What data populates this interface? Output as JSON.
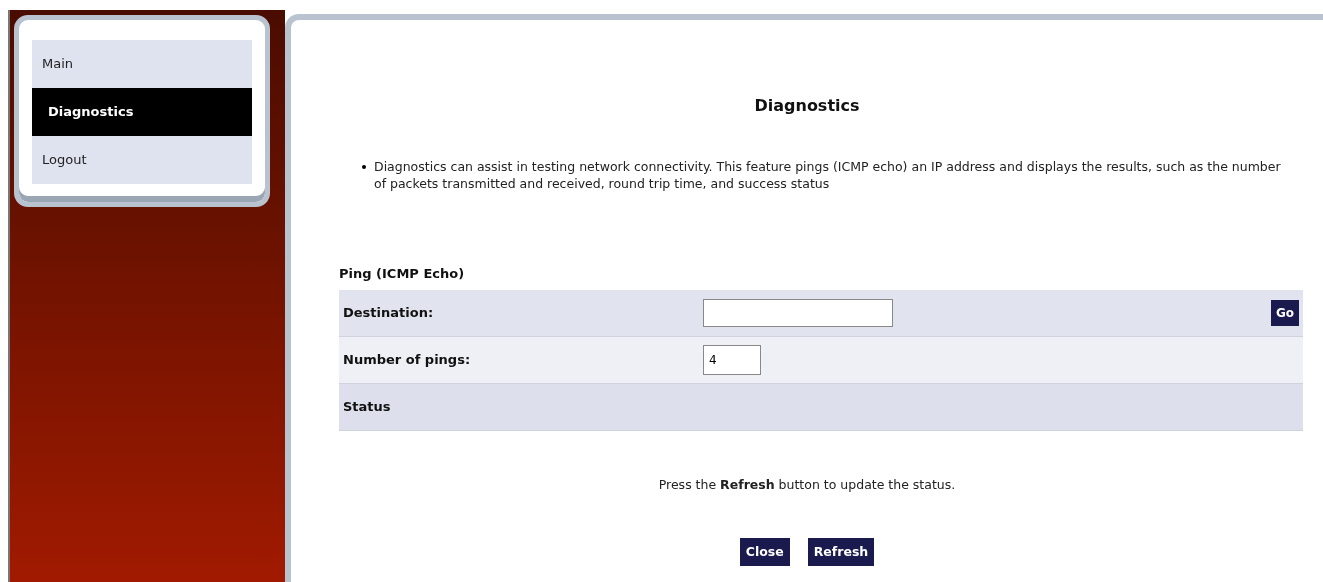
{
  "sidebar": {
    "items": [
      {
        "label": "Main",
        "selected": false
      },
      {
        "label": "Diagnostics",
        "selected": true
      },
      {
        "label": "Logout",
        "selected": false
      }
    ]
  },
  "content": {
    "title": "Diagnostics",
    "bullets": [
      "Diagnostics can assist in testing network connectivity. This feature pings (ICMP echo) an IP address and displays the results, such as the number of packets transmitted and received, round trip time, and success status"
    ],
    "section_title": "Ping (ICMP Echo)",
    "rows": [
      {
        "kind": "input_with_button",
        "label": "Destination:",
        "value": "",
        "button": "Go"
      },
      {
        "kind": "input",
        "label": "Number of pings:",
        "value": "4"
      },
      {
        "kind": "header",
        "label": "Status"
      }
    ],
    "note": "Press the **Refresh** button to update the status.",
    "buttons": [
      "Close",
      "Refresh"
    ]
  }
}
